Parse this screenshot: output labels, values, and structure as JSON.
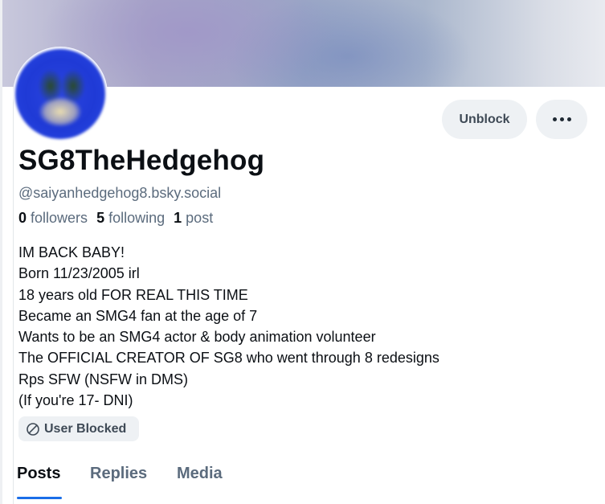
{
  "profile": {
    "display_name": "SG8TheHedgehog",
    "handle": "@saiyanhedgehog8.bsky.social",
    "followers_count": "0",
    "followers_label": "followers",
    "following_count": "5",
    "following_label": "following",
    "posts_count": "1",
    "posts_label": "post",
    "bio": [
      "IM BACK BABY!",
      "Born 11/23/2005 irl",
      "18 years old FOR REAL THIS TIME",
      "Became an SMG4 fan at the age of 7",
      "Wants to be an SMG4 actor & body animation volunteer",
      "The OFFICIAL CREATOR OF SG8 who went through 8 redesigns",
      "Rps SFW (NSFW in DMS)",
      "(If you're 17- DNI)"
    ],
    "blocked_label": "User Blocked"
  },
  "actions": {
    "unblock_label": "Unblock",
    "more_icon": "ellipsis-icon"
  },
  "tabs": [
    {
      "label": "Posts",
      "active": true
    },
    {
      "label": "Replies",
      "active": false
    },
    {
      "label": "Media",
      "active": false
    }
  ],
  "colors": {
    "accent": "#1a6ee8",
    "muted_text": "#5b6b7d",
    "pill_bg": "#eef1f4"
  }
}
